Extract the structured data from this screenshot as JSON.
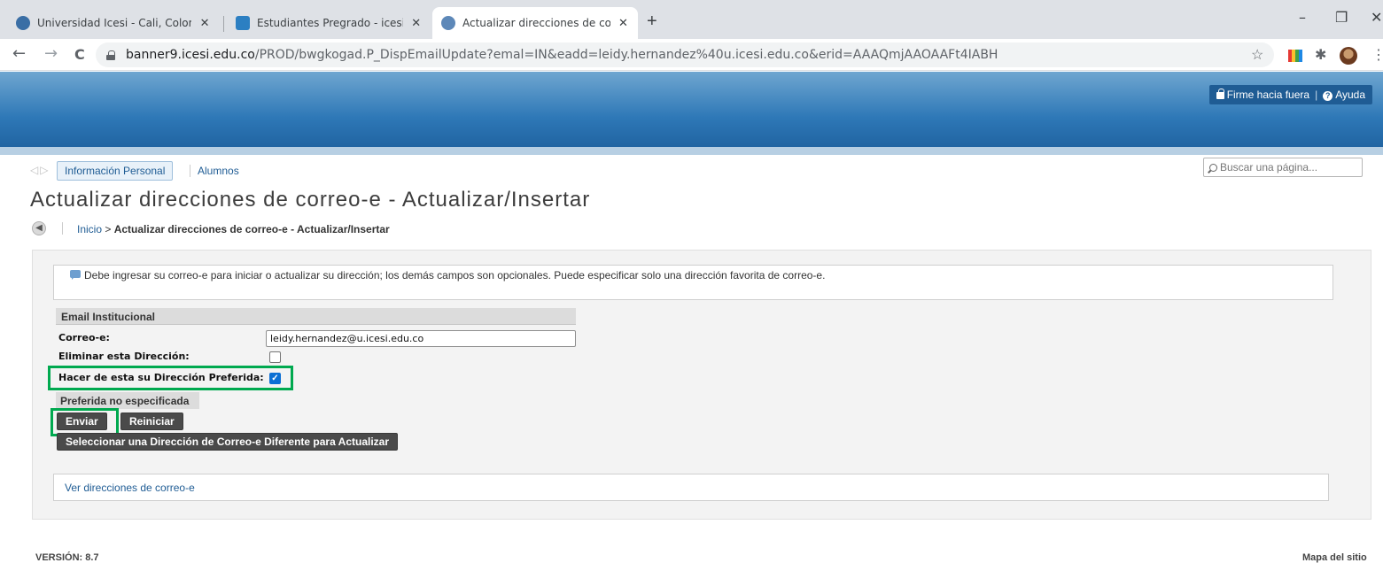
{
  "browser": {
    "tabs": [
      {
        "title": "Universidad Icesi - Cali, Colombia",
        "active": false
      },
      {
        "title": "Estudiantes Pregrado - icesi.edu.co",
        "active": false
      },
      {
        "title": "Actualizar direcciones de correo-e",
        "active": true
      }
    ],
    "close_glyph": "✕",
    "new_tab_glyph": "+",
    "window_controls": {
      "minimize": "–",
      "maximize": "❐",
      "close": "✕"
    },
    "nav": {
      "back": "←",
      "forward": "→",
      "reload": "C"
    },
    "url_host": "banner9.icesi.edu.co",
    "url_path": "/PROD/bwgkogad.P_DispEmailUpdate?emal=IN&eadd=leidy.hernandez%40u.icesi.edu.co&erid=AAAQmjAAOAAFt4IABH",
    "star_glyph": "☆",
    "puzzle_glyph": "✱",
    "kebab_glyph": "⋮"
  },
  "header": {
    "signout_label": "Firme hacia fuera",
    "separator": "|",
    "help_label": "Ayuda",
    "help_glyph": "?"
  },
  "nav_tabs": {
    "arrows": "◁▷",
    "active_label": "Información Personal",
    "other_label": "Alumnos"
  },
  "search": {
    "placeholder": "Buscar una página..."
  },
  "page": {
    "title": "Actualizar direcciones de correo-e - Actualizar/Insertar",
    "back_glyph": "◀",
    "breadcrumb_home": "Inicio",
    "breadcrumb_separator": ">",
    "breadcrumb_current": "Actualizar direcciones de correo-e - Actualizar/Insertar"
  },
  "form": {
    "info_text": "Debe ingresar su correo-e para iniciar o actualizar su dirección; los demás campos son opcionales. Puede especificar solo una dirección favorita de correo-e.",
    "section_title": "Email Institucional",
    "email_label": "Correo-e:",
    "email_value": "leidy.hernandez@u.icesi.edu.co",
    "delete_label": "Eliminar esta Dirección:",
    "delete_checked": false,
    "preferred_label": "Hacer de esta su Dirección Preferida:",
    "preferred_checked": true,
    "check_glyph": "✓",
    "preferred_status": "Preferida no especificada",
    "submit_label": "Enviar",
    "reset_label": "Reiniciar",
    "select_other_label": "Seleccionar una Dirección de Correo-e Diferente para Actualizar",
    "view_link": "Ver direcciones de correo-e"
  },
  "footer": {
    "version": "VERSIÓN: 8.7",
    "sitemap": "Mapa del sitio"
  },
  "colors": {
    "accent_blue": "#1f5c94",
    "highlight_green": "#00a94f",
    "button_dark": "#4a4a4a",
    "checkbox_blue": "#0b6fd4"
  }
}
